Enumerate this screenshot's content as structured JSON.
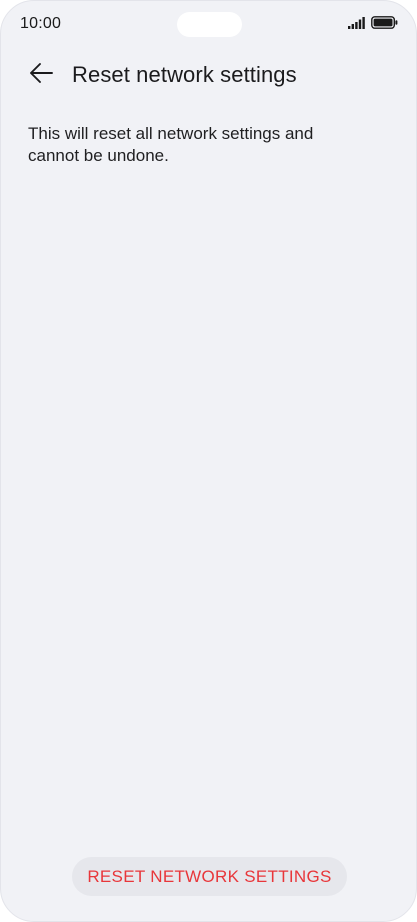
{
  "status_bar": {
    "time": "10:00",
    "icons": [
      "signal-icon",
      "battery-icon"
    ]
  },
  "header": {
    "back_icon": "arrow-left-icon",
    "title": "Reset network settings"
  },
  "main": {
    "description": "This will reset all network settings and cannot be undone."
  },
  "actions": {
    "reset_label": "RESET NETWORK SETTINGS"
  },
  "colors": {
    "background": "#f1f2f6",
    "accent_red": "#e8363a",
    "button_bg": "#e6e7ec",
    "text": "#1b1b1d"
  }
}
